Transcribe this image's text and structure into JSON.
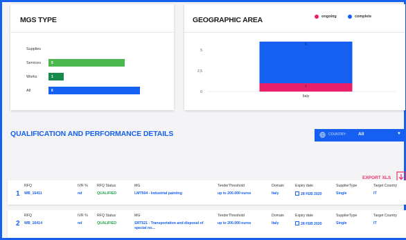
{
  "mgs_type": {
    "title": "MGS TYPE",
    "bars": [
      {
        "label": "Supplies",
        "value": null,
        "color": ""
      },
      {
        "label": "Services",
        "value": 5,
        "color": "#4cb84f"
      },
      {
        "label": "Works",
        "value": 1,
        "color": "#168a4a"
      },
      {
        "label": "All",
        "value": 6,
        "color": "#1560f0"
      }
    ]
  },
  "geographic_area": {
    "title": "GEOGRAPHIC AREA",
    "legend": [
      {
        "label": "ongoing",
        "color": "#e8206a"
      },
      {
        "label": "complete",
        "color": "#1560f0"
      }
    ]
  },
  "chart_data": {
    "type": "bar",
    "categories": [
      "Italy"
    ],
    "series": [
      {
        "name": "ongoing",
        "values": [
          1
        ],
        "color": "#e8206a"
      },
      {
        "name": "complete",
        "values": [
          5
        ],
        "color": "#1560f0"
      }
    ],
    "stacked": true,
    "yticks": [
      "5",
      "2,5",
      "0"
    ],
    "ylim": [
      0,
      6
    ]
  },
  "section": {
    "title": "QUALIFICATION AND PERFORMANCE DETAILS",
    "country_label": "COUNTRY:",
    "country_value": "All",
    "caret": "▼",
    "export_label": "EXPORT XLS"
  },
  "columns": [
    "RFQ",
    "IVR %",
    "RFQ Status",
    "MG",
    "TenderThreshold",
    "Domain",
    "Expiry date",
    "SupplierType",
    "Target Country"
  ],
  "rows": [
    {
      "num": "1",
      "rfq": "WB_16411",
      "ivr": "nd",
      "status": "QUALIFIED",
      "mg": "LMT504 - Industrial painting",
      "threshold": "up to 200.000 euros",
      "domain": "Italy",
      "expiry": "28 FEB 2020",
      "supplier_type": "Single",
      "target_country": "IT"
    },
    {
      "num": "2",
      "rfq": "WB_16414",
      "ivr": "nd",
      "status": "QUALIFIED",
      "mg": "SRT521 - Transportation and disposal of special no...",
      "threshold": "up to 200.000 euros",
      "domain": "Italy",
      "expiry": "28 FEB 2020",
      "supplier_type": "Single",
      "target_country": "IT"
    }
  ]
}
